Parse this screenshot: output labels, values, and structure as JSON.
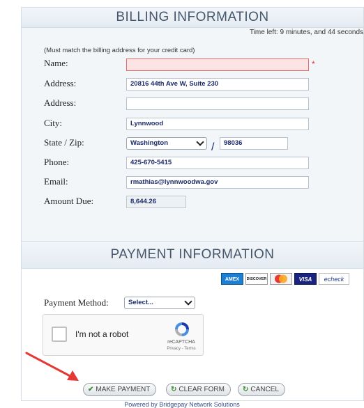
{
  "billing": {
    "title": "BILLING INFORMATION",
    "time_left": "Time left: 9 minutes, and 44 seconds",
    "note": "(Must match the billing address for your credit card)",
    "fields": {
      "name": {
        "label": "Name:",
        "value": "",
        "required_mark": "*"
      },
      "address1": {
        "label": "Address:",
        "value": "20816 44th Ave W, Suite 230"
      },
      "address2": {
        "label": "Address:",
        "value": ""
      },
      "city": {
        "label": "City:",
        "value": "Lynnwood"
      },
      "state_zip": {
        "label": "State / Zip:",
        "state": "Washington",
        "separator": "/",
        "zip": "98036"
      },
      "phone": {
        "label": "Phone:",
        "value": "425-670-5415"
      },
      "email": {
        "label": "Email:",
        "value": "rmathias@lynnwoodwa.gov"
      },
      "amount_due": {
        "label": "Amount Due:",
        "value": "8,644.26"
      }
    }
  },
  "payment": {
    "title": "PAYMENT INFORMATION",
    "cards": [
      "AMEX",
      "DISCOVER",
      "mastercard",
      "VISA",
      "echeck"
    ],
    "method": {
      "label": "Payment Method:",
      "value": "Select..."
    }
  },
  "captcha": {
    "text": "I'm not a robot",
    "brand": "reCAPTCHA",
    "terms": "Privacy - Terms"
  },
  "buttons": {
    "make_payment": "MAKE PAYMENT",
    "clear_form": "CLEAR FORM",
    "cancel": "CANCEL"
  },
  "footer": {
    "text": "Powered by Bridgepay Network Solutions"
  },
  "colors": {
    "error_bg": "#fde4e4",
    "accent_red": "#e53935",
    "title_text": "#46566b"
  }
}
